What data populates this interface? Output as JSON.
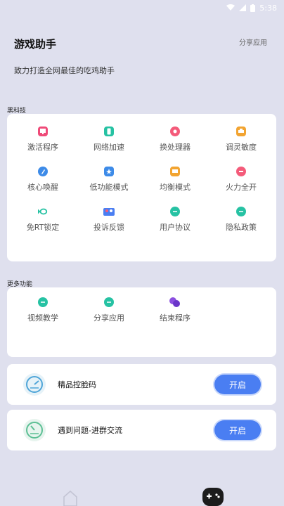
{
  "status_bar": {
    "time": "5:38"
  },
  "header": {
    "title": "游戏助手",
    "share_label": "分享应用",
    "subtitle": "致力打造全网最佳的吃鸡助手"
  },
  "section_black_tech": {
    "label": "黑科技",
    "items": [
      {
        "label": "激活程序",
        "icon": "monitor-icon",
        "color": "#ef4a78"
      },
      {
        "label": "网络加速",
        "icon": "phone-icon",
        "color": "#26c2a3"
      },
      {
        "label": "换处理器",
        "icon": "chip-icon",
        "color": "#f45b7a"
      },
      {
        "label": "调灵敏度",
        "icon": "printer-icon",
        "color": "#f2a431"
      },
      {
        "label": "核心唤醒",
        "icon": "rocket-icon",
        "color": "#3d8be8"
      },
      {
        "label": "低功能模式",
        "icon": "battery-icon",
        "color": "#3d8be8"
      },
      {
        "label": "均衡模式",
        "icon": "chat-icon",
        "color": "#f2a431"
      },
      {
        "label": "火力全开",
        "icon": "fire-icon",
        "color": "#f45b7a"
      },
      {
        "label": "免RT锁定",
        "icon": "fish-icon",
        "color": "#26c2a3"
      },
      {
        "label": "投诉反馈",
        "icon": "feedback-icon",
        "color": "#4a7ef2"
      },
      {
        "label": "用户协议",
        "icon": "agreement-icon",
        "color": "#26c2a3"
      },
      {
        "label": "隐私政策",
        "icon": "privacy-icon",
        "color": "#26c2a3"
      }
    ]
  },
  "section_more": {
    "label": "更多功能",
    "items": [
      {
        "label": "视频教学",
        "icon": "video-icon",
        "color": "#26c2a3"
      },
      {
        "label": "分享应用",
        "icon": "share-icon",
        "color": "#26c2a3"
      },
      {
        "label": "结束程序",
        "icon": "exit-icon",
        "color": "#8b4fe0"
      }
    ]
  },
  "rows": [
    {
      "text": "精品控脸码",
      "button": "开启"
    },
    {
      "text": "遇到问题-进群交流",
      "button": "开启"
    }
  ],
  "bottom_nav": {
    "items": [
      {
        "icon": "home-icon"
      },
      {
        "icon": "gamepad-icon"
      }
    ]
  }
}
